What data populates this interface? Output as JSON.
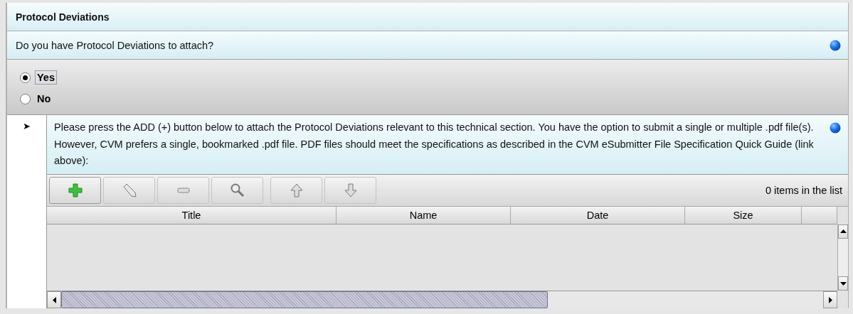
{
  "section": {
    "title": "Protocol Deviations"
  },
  "question": {
    "text": "Do you have Protocol Deviations to attach?"
  },
  "options": [
    {
      "label": "Yes",
      "selected": true
    },
    {
      "label": "No",
      "selected": false
    }
  ],
  "attachments": {
    "expand_marker": "➤",
    "instructions": "Please press the ADD (+) button below to attach the Protocol Deviations relevant to this technical section. You have the option to submit a single or multiple .pdf file(s). However, CVM prefers a single, bookmarked .pdf file. PDF files should meet the specifications as described in the CVM eSubmitter File Specification Quick Guide (link above):",
    "item_count": "0 items in the list",
    "columns": [
      "Title",
      "Name",
      "Date",
      "Size"
    ]
  }
}
